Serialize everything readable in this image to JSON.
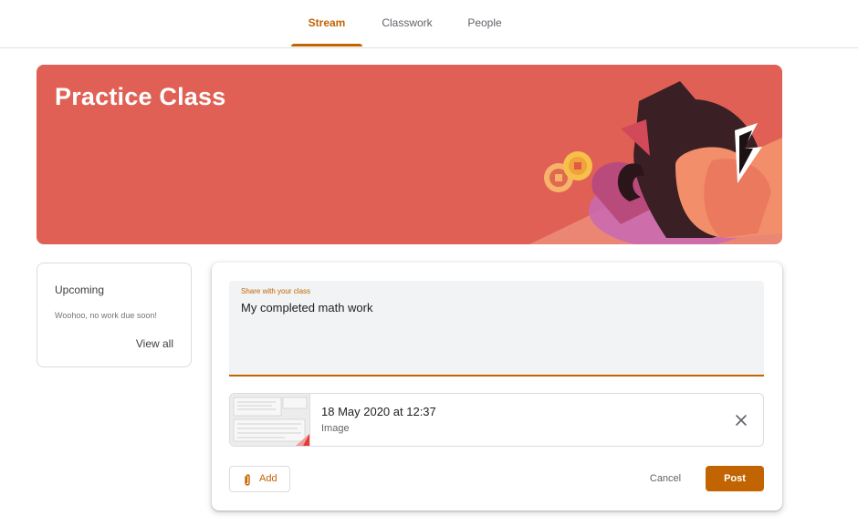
{
  "nav": {
    "tabs": [
      {
        "label": "Stream",
        "active": true
      },
      {
        "label": "Classwork",
        "active": false
      },
      {
        "label": "People",
        "active": false
      }
    ]
  },
  "banner": {
    "title": "Practice Class",
    "color": "#e06055"
  },
  "upcoming": {
    "title": "Upcoming",
    "empty_text": "Woohoo, no work due soon!",
    "view_all": "View all"
  },
  "composer": {
    "field_label": "Share with your class",
    "field_value": "My completed math work",
    "attachment": {
      "title": "18 May 2020 at 12:37",
      "type": "Image",
      "icon": "close-icon"
    },
    "add_label": "Add",
    "cancel_label": "Cancel",
    "post_label": "Post"
  },
  "colors": {
    "accent": "#c26401"
  }
}
